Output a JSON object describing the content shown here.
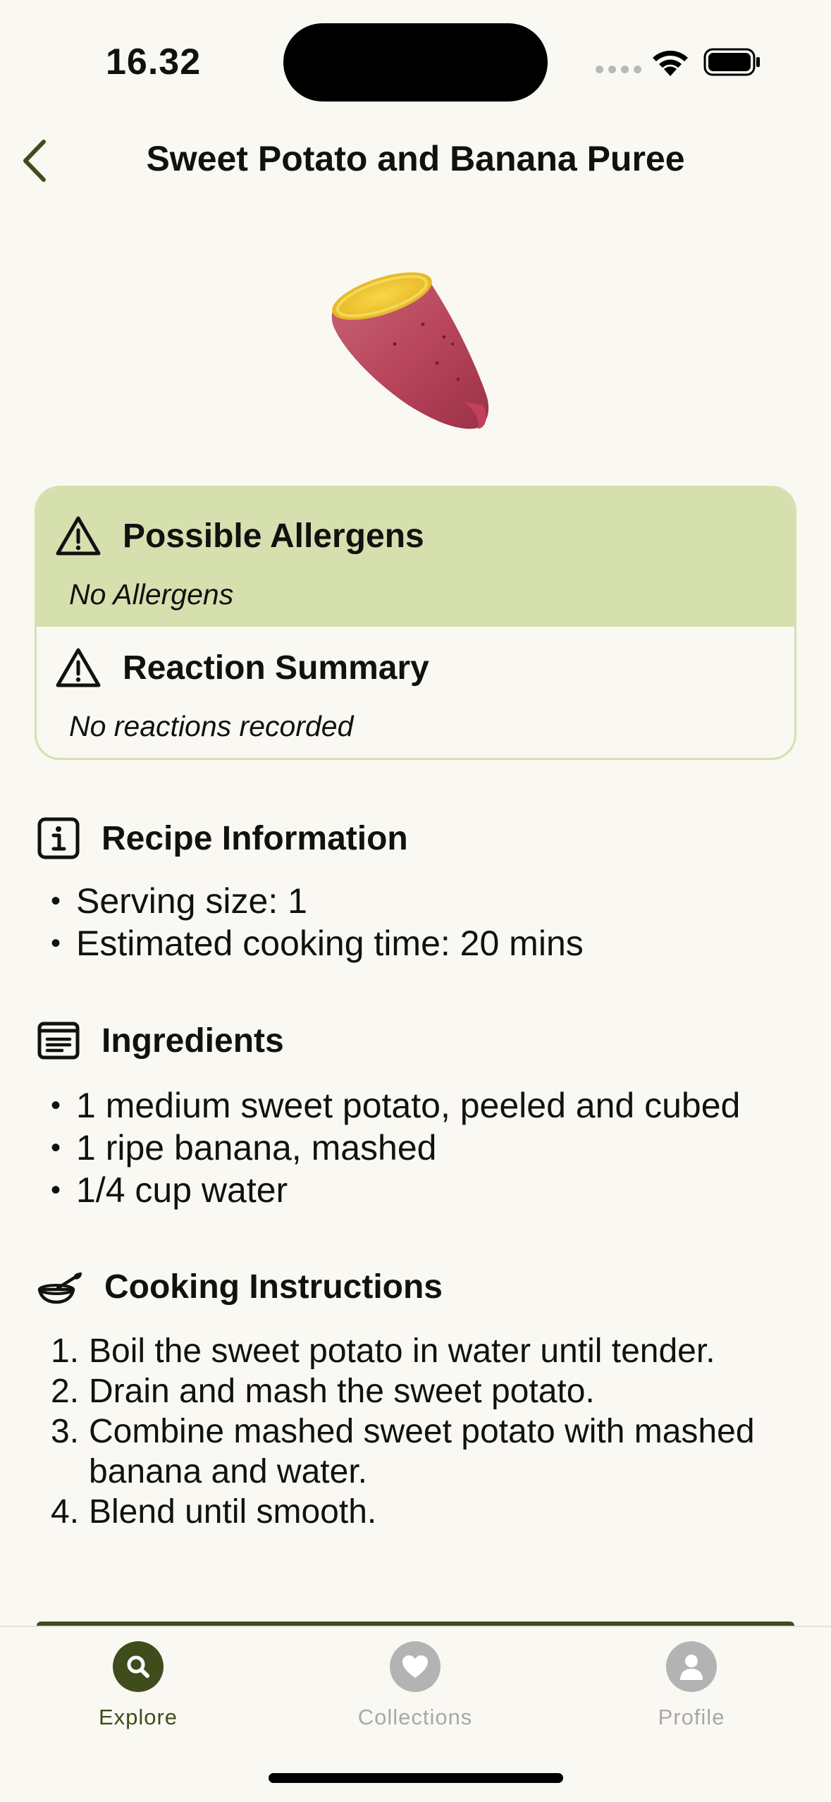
{
  "status_bar": {
    "time": "16.32"
  },
  "header": {
    "title": "Sweet Potato and Banana Puree",
    "back_icon": "chevron-left-icon"
  },
  "hero": {
    "image": "sweet-potato-emoji"
  },
  "allergens": {
    "title": "Possible Allergens",
    "value": "No Allergens"
  },
  "reactions": {
    "title": "Reaction Summary",
    "value": "No reactions recorded"
  },
  "recipe_info": {
    "title": "Recipe Information",
    "items": [
      "Serving size: 1",
      "Estimated cooking time: 20 mins"
    ]
  },
  "ingredients": {
    "title": "Ingredients",
    "items": [
      "1 medium sweet potato, peeled and cubed",
      "1 ripe banana, mashed",
      "1/4 cup water"
    ]
  },
  "instructions": {
    "title": "Cooking Instructions",
    "steps": [
      {
        "num": "1.",
        "text": "Boil the sweet potato in water until tender."
      },
      {
        "num": "2.",
        "text": "Drain and mash the sweet potato."
      },
      {
        "num": "3.",
        "text": "Combine mashed sweet potato with mashed banana and water."
      },
      {
        "num": "4.",
        "text": "Blend until smooth."
      }
    ]
  },
  "tabs": [
    {
      "label": "Explore",
      "icon": "search-icon",
      "active": true
    },
    {
      "label": "Collections",
      "icon": "heart-icon",
      "active": false
    },
    {
      "label": "Profile",
      "icon": "person-icon",
      "active": false
    }
  ],
  "colors": {
    "background": "#faf8f2",
    "accent_green": "#3f4d1c",
    "card_green": "#d6e0af",
    "inactive": "#b3b3b3"
  }
}
